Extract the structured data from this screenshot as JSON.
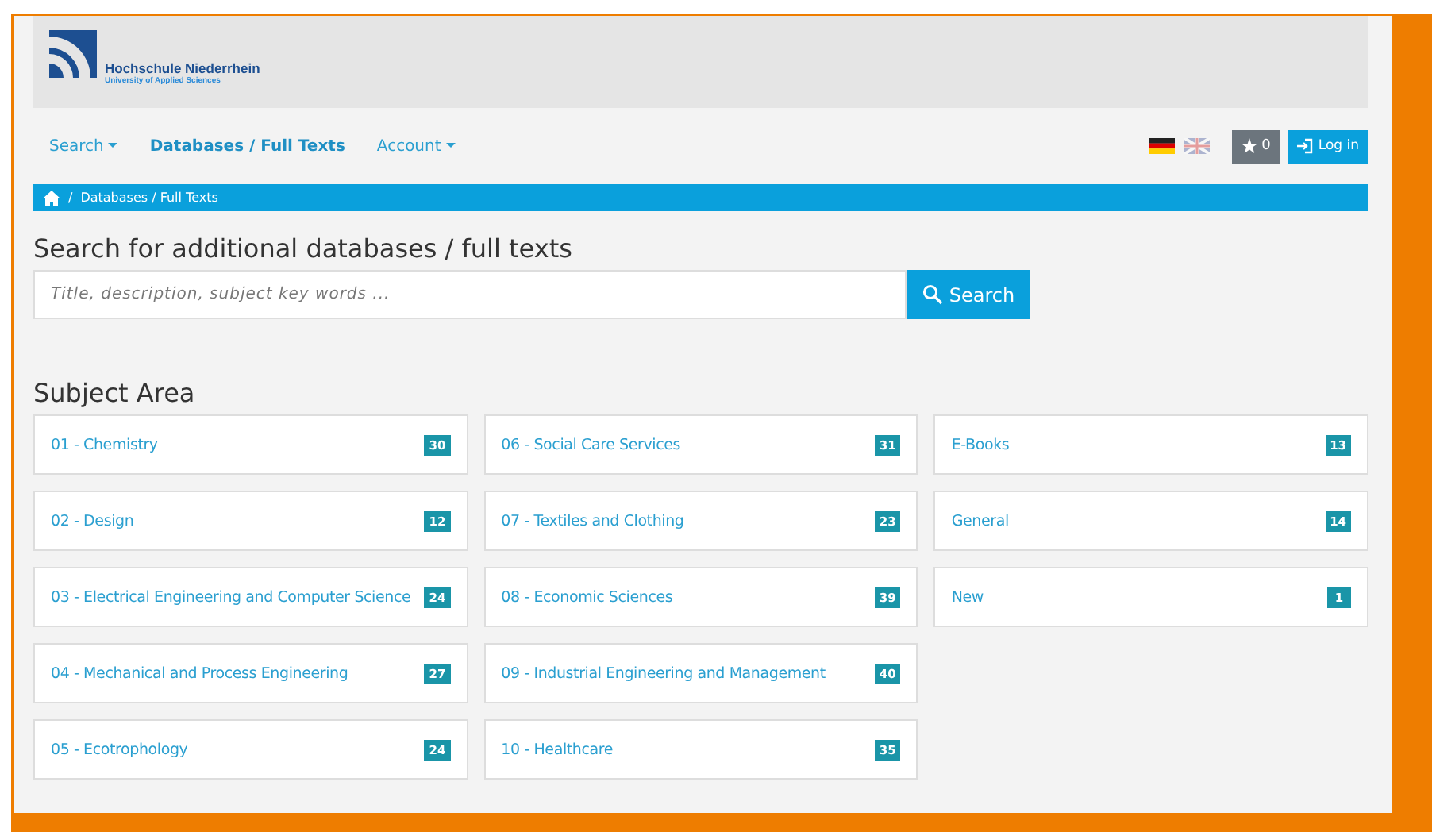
{
  "header": {
    "logo_title": "Hochschule Niederrhein",
    "logo_subtitle": "University of Applied Sciences"
  },
  "nav": [
    {
      "label": "Search",
      "dropdown": true,
      "selected": false
    },
    {
      "label": "Databases / Full Texts",
      "dropdown": false,
      "selected": true
    },
    {
      "label": "Account",
      "dropdown": true,
      "selected": false
    }
  ],
  "toolbar": {
    "languages": [
      {
        "kind": "german",
        "selected": true
      },
      {
        "kind": "english",
        "selected": false
      }
    ],
    "favorites_count": "0",
    "login_label": "Log in"
  },
  "breadcrumb": [
    {
      "separator": "/",
      "label": "Databases / Full Texts"
    }
  ],
  "search": {
    "heading": "Search for additional databases / full texts",
    "placeholder": "Title, description, subject key words ...",
    "button": "Search"
  },
  "subject_area": {
    "heading": "Subject Area",
    "columns": [
      [
        {
          "label": "01 - Chemistry",
          "count": "30"
        },
        {
          "label": "02 - Design",
          "count": "12"
        },
        {
          "label": "03 - Electrical Engineering and Computer Science",
          "count": "24"
        },
        {
          "label": "04 - Mechanical and Process Engineering",
          "count": "27"
        },
        {
          "label": "05 - Ecotrophology",
          "count": "24"
        }
      ],
      [
        {
          "label": "06 - Social Care Services",
          "count": "31"
        },
        {
          "label": "07 - Textiles and Clothing",
          "count": "23"
        },
        {
          "label": "08 - Economic Sciences",
          "count": "39"
        },
        {
          "label": "09 - Industrial Engineering and Management",
          "count": "40"
        },
        {
          "label": "10 - Healthcare",
          "count": "35"
        }
      ],
      [
        {
          "label": "E-Books",
          "count": "13"
        },
        {
          "label": "General",
          "count": "14"
        },
        {
          "label": "New",
          "count": "1"
        }
      ]
    ]
  }
}
